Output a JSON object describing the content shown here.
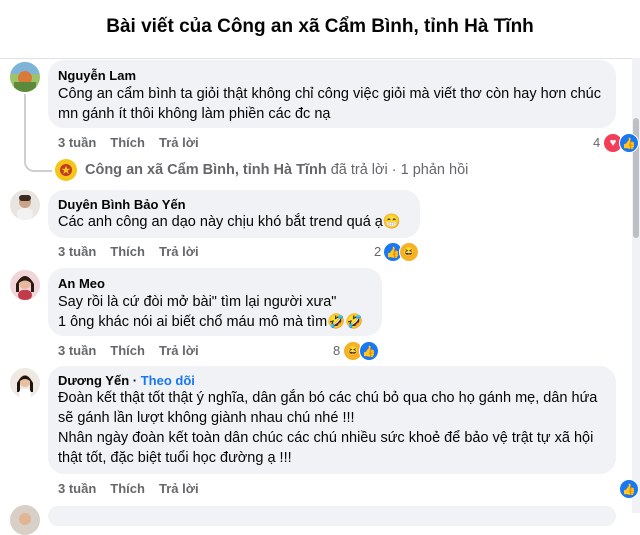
{
  "header": {
    "title": "Bài viết của Công an xã Cẩm Bình, tỉnh Hà Tĩnh"
  },
  "comments": [
    {
      "author": "Nguyễn Lam",
      "lines": [
        "Công an cẩm bình ta giỏi thật không chỉ công việc giỏi mà viết thơ còn hay hơn chúc",
        "mn gánh ít thôi không làm phiền các đc nạ"
      ],
      "time": "3 tuần",
      "like_label": "Thích",
      "reply_label": "Trả lời",
      "reaction_count": "4"
    },
    {
      "author": "Duyên Bình Bảo Yến",
      "lines": [
        "Các anh công an dạo này chịu khó bắt trend quá ạ😁"
      ],
      "time": "3 tuần",
      "like_label": "Thích",
      "reply_label": "Trả lời",
      "reaction_count": "2"
    },
    {
      "author": "An Meo",
      "lines": [
        "Say rồi là cứ đòi mở bài\" tìm lại người xưa\"",
        "1 ông khác nói ai biết chổ máu mô mà tìm🤣🤣"
      ],
      "time": "3 tuần",
      "like_label": "Thích",
      "reply_label": "Trả lời",
      "reaction_count": "8"
    },
    {
      "author": "Dương Yến",
      "follow": "Theo dõi",
      "lines": [
        "Đoàn kết thật tốt thật ý nghĩa, dân gắn bó các chú bỏ qua cho họ gánh mẹ, dân hứa",
        "sẽ gánh lần lượt không giành nhau chú nhé !!!",
        "Nhân ngày đoàn kết toàn dân chúc các chú nhiều sức khoẻ để bảo vệ trật tự xã hội",
        "thật tốt, đặc biệt tuổi học đường ạ !!!"
      ],
      "time": "3 tuần",
      "like_label": "Thích",
      "reply_label": "Trả lời"
    }
  ],
  "reply_summary": {
    "page_name": "Công an xã Cẩm Bình, tỉnh Hà Tĩnh",
    "text": "đã trả lời · 1 phản hồi"
  },
  "colors": {
    "bubble": "#f0f2f5",
    "meta": "#65676b",
    "accent": "#1877f2"
  }
}
